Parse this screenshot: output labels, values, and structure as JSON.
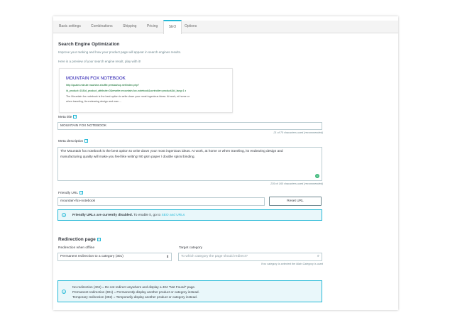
{
  "tabs": [
    {
      "label": "Basic settings"
    },
    {
      "label": "Combinations"
    },
    {
      "label": "Shipping"
    },
    {
      "label": "Pricing"
    },
    {
      "label": "SEO"
    },
    {
      "label": "Options"
    }
  ],
  "seo": {
    "title": "Search Engine Optimization",
    "subtitle": "Improve your ranking and how your product page will appear in search engines results.",
    "preview_intro": "Here is a preview of your search engine result, play with it!",
    "preview": {
      "title": "MOUNTAIN FOX NOTEBOOK",
      "url_line1": "http://quaint-minute.machine-shuffle.prestashop.net/index.php?",
      "url_line2": "id_product=10&id_product_attribute=0&rewrite=mountain-fox-notebook&controller=product&id_lang=1",
      "desc_line1": "The Mountain fox notebook is the best option to write down your most ingenious ideas. At work, at home or",
      "desc_line2": "when traveling, its endearing design and man ..."
    },
    "meta_title_label": "Meta title",
    "meta_title_value": "MOUNTAIN FOX NOTEBOOK",
    "meta_title_hint": "21 of 70 characters used (recommended)",
    "meta_desc_label": "Meta description",
    "meta_desc_line1": "The Mountain fox notebook is the best option to write down your most ingenious ideas. At work, at home or when traveling, its endearing design and",
    "meta_desc_line2": "manufacturing quality will make you feel like writing! 90 gsm paper / double spiral binding.",
    "meta_desc_hint": "239 of 160 characters used (recommended)",
    "friendly_url_label": "Friendly URL",
    "friendly_url_value": "mountain-fox-notebook",
    "reset_url_label": "Reset URL",
    "friendly_alert_bold": "Friendly URLs are currently disabled.",
    "friendly_alert_text": " To enable it, go to ",
    "friendly_alert_link": "SEO and URLs"
  },
  "redirection": {
    "title": "Redirection page",
    "when_offline_label": "Redirection when offline",
    "when_offline_value": "Permanent redirection to a category (301)",
    "target_label": "Target category",
    "target_placeholder": "To which category the page should redirect?",
    "target_hint": "If no category is selected the Main Category is used",
    "info_line1": "No redirection (404) = Do not redirect anywhere and display a 404 \"Not Found\" page.",
    "info_line2": "Permanent redirection (301) = Permanently display another product or category instead.",
    "info_line3": "Temporary redirection (302) = Temporarily display another product or category instead."
  },
  "icons": {
    "help": "?",
    "info": "i",
    "search": "⌕",
    "select_caret": "⬍",
    "grammar": "☺"
  },
  "colors": {
    "accent": "#25b9d7",
    "link_title": "#1a0dab",
    "link_url": "#006621",
    "alert_bg": "#e9f7fa"
  }
}
